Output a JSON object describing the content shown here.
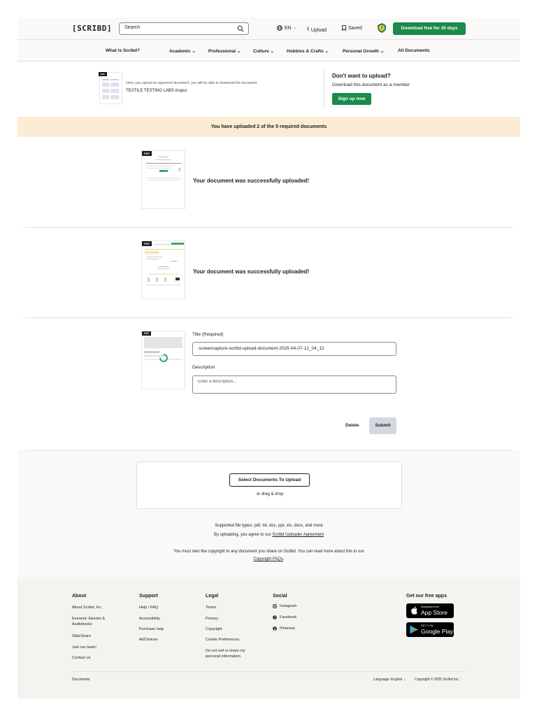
{
  "header": {
    "logo": "[SCRIBD]",
    "search_placeholder": "Search",
    "language": "EN",
    "upload": "Upload",
    "saved": "Saved",
    "download_button": "Download free for 30 days"
  },
  "nav": {
    "items": [
      "What is Scribd?",
      "Academic",
      "Professional",
      "Culture",
      "Hobbies & Crafts",
      "Personal Growth",
      "All Documents"
    ]
  },
  "prompt": {
    "info": "Once you upload an approved document, you will be able to download the document",
    "doc_title": "TEXTILE TESTING LABS tirupur",
    "dont_upload": "Don't want to upload?",
    "download_member": "Download this document as a member",
    "signup": "Sign up now"
  },
  "banner": "You have uploaded 2 of the 5 required documents",
  "docs": {
    "pdf_label": "PDF",
    "success_message": "Your document was successfully uploaded!"
  },
  "form": {
    "title_label": "Title (Required)",
    "title_value": "screencapture-scribd-upload-document-2025-04-07-12_04_12",
    "description_label": "Description",
    "description_placeholder": "Enter a description...",
    "delete": "Delete",
    "submit": "Submit"
  },
  "dropzone": {
    "select_button": "Select Documents To Upload",
    "drag_text": "or drag & drop"
  },
  "info": {
    "supported": "Supported file types: pdf, txt, doc, ppt, xls, docx, and more",
    "agree_prefix": "By uploading, you agree to our",
    "agree_link": "Scribd Uploader Agreement",
    "copyright_line": "You must own the copyright to any document you share on Scribd. You can read more about this in our",
    "copyright_link": "Copyright FAQs",
    "copyright_end": "."
  },
  "footer": {
    "about": {
      "title": "About",
      "links": [
        "About Scribd, Inc.",
        "Everand: Ebooks & Audiobooks",
        "SlideShare",
        "Join our team!",
        "Contact us"
      ]
    },
    "support": {
      "title": "Support",
      "links": [
        "Help / FAQ",
        "Accessibility",
        "Purchase help",
        "AdChoices"
      ]
    },
    "legal": {
      "title": "Legal",
      "links": [
        "Terms",
        "Privacy",
        "Copyright",
        "Cookie Preferences",
        "Do not sell or share my personal information"
      ]
    },
    "social": {
      "title": "Social",
      "links": [
        "Instagram",
        "Facebook",
        "Pinterest"
      ]
    },
    "apps": {
      "title": "Get our free apps",
      "appstore_small": "Download on the",
      "appstore_big": "App Store",
      "google_small": "GET IT ON",
      "google_big": "Google Play"
    },
    "documents": "Documents",
    "language": "Language: English",
    "copyright": "Copyright © 2025 Scribd Inc."
  },
  "colors": {
    "brand_green": "#1b8a4b",
    "banner_bg": "#fbecd3",
    "submit_bg": "#d3d8e0",
    "accent_teal": "#1e9a8a"
  }
}
